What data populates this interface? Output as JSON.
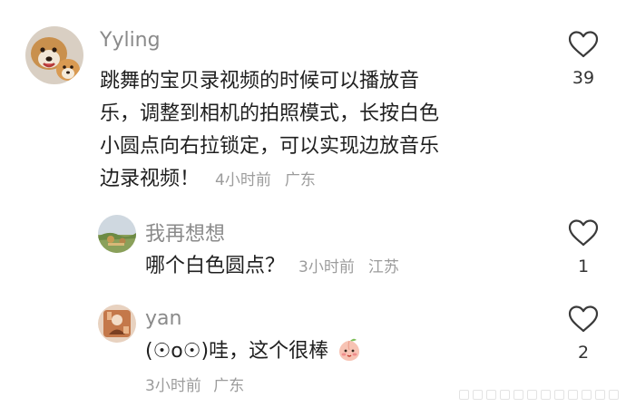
{
  "comments": [
    {
      "username": "Yyling",
      "text_lines": [
        "跳舞的宝贝录视频的时候可以播放音",
        "乐，调整到相机的拍照模式，长按白色",
        "小圆点向右拉锁定，可以实现边放音乐",
        "边录视频！"
      ],
      "time": "4小时前",
      "location": "广东",
      "likes": "39",
      "avatar": "dog-photo-avatar",
      "like_icon": "heart-outline-icon"
    },
    {
      "username": "我再想想",
      "text": "哪个白色圆点？",
      "time": "3小时前",
      "location": "江苏",
      "likes": "1",
      "avatar": "landscape-photo-avatar",
      "like_icon": "heart-outline-icon"
    },
    {
      "username": "yan",
      "text": "(☉o☉)哇，这个很棒",
      "emoji": "peach-blush-emoji",
      "time": "3小时前",
      "location": "广东",
      "likes": "2",
      "avatar": "illustrated-avatar",
      "like_icon": "heart-outline-icon"
    }
  ],
  "colors": {
    "username": "#8a8a8a",
    "body_text": "#1f1f1f",
    "meta": "#9c9c9c",
    "heart_stroke": "#3a3a3a"
  }
}
